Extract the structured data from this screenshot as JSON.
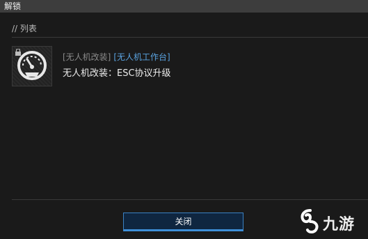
{
  "window": {
    "title": "解锁"
  },
  "section": {
    "header": "// 列表"
  },
  "item": {
    "category": "[无人机改装]",
    "tag": "[无人机工作台]",
    "name": "无人机改装：ESC协议升级",
    "icon": "speedometer-icon",
    "badge_icon": "lock-icon"
  },
  "footer": {
    "close_label": "关闭"
  },
  "watermark": {
    "text": "九游",
    "icon": "jiuyou-logo-icon"
  },
  "colors": {
    "accent": "#3b82c4",
    "tag": "#5aa3e0",
    "background": "#1a1a1a"
  }
}
